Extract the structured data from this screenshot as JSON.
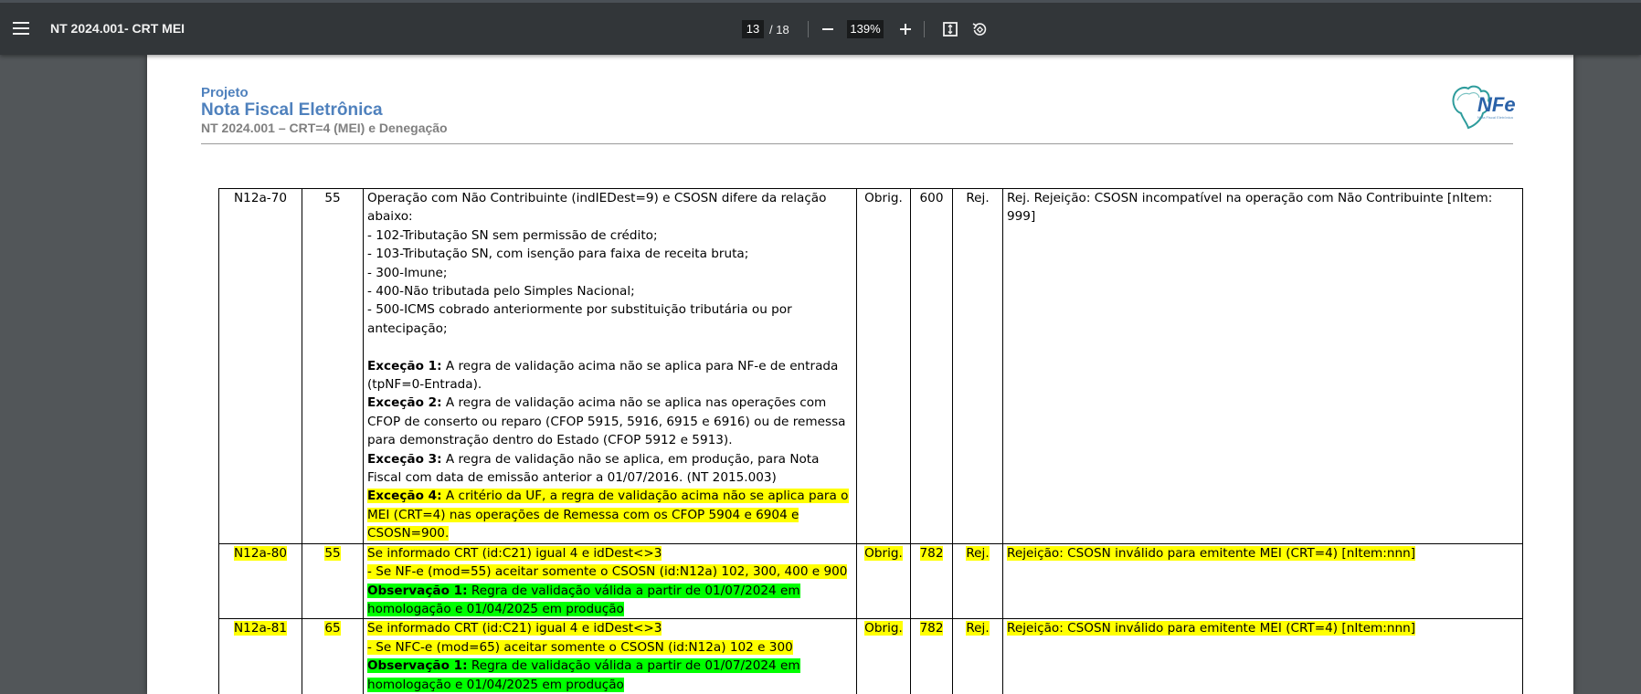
{
  "viewer": {
    "title": "NT 2024.001- CRT MEI",
    "current_page": "13",
    "total_pages": "/ 18",
    "zoom": "139%"
  },
  "doc_header": {
    "line1": "Projeto",
    "line2": "Nota Fiscal Eletrônica",
    "line3": "NT 2024.001 – CRT=4 (MEI) e Denegação",
    "logo_text": "NFe",
    "logo_subtext": "Nota Fiscal Eletrônica"
  },
  "colors": {
    "highlight_yellow": "#ffff00",
    "highlight_green": "#00ff00",
    "header_blue": "#4f81bd",
    "toolbar": "#323639"
  },
  "rows": [
    {
      "id": "N12a-70",
      "mod": "55",
      "desc": {
        "p1": "Operação com Não Contribuinte (indIEDest=9) e CSOSN difere da relação abaixo:",
        "items": [
          "- 102-Tributação SN sem permissão de crédito;",
          "- 103-Tributação SN, com isenção para faixa de receita bruta;",
          "- 300-Imune;",
          "- 400-Não tributada pelo Simples Nacional;",
          "- 500-ICMS cobrado anteriormente por substituição tributária ou por antecipação;"
        ],
        "exc1_label": "Exceção 1:",
        "exc1_text": " A regra de validação acima não se aplica para NF-e de entrada (tpNF=0-Entrada).",
        "exc2_label": "Exceção 2:",
        "exc2_text": " A regra de validação acima não se aplica nas operações com CFOP de conserto ou reparo (CFOP 5915, 5916, 6915 e 6916) ou de remessa para demonstração dentro do Estado (CFOP 5912 e 5913).",
        "exc3_label": "Exceção 3:",
        "exc3_text": " A regra de validação não se aplica, em produção, para Nota Fiscal com data de emissão anterior a 01/07/2016. (NT 2015.003)",
        "exc4_label": "Exceção 4:",
        "exc4_text": " A critério da UF, a regra de validação acima não se aplica para o MEI (CRT=4) nas operações de Remessa com os CFOP 5904 e 6904 e CSOSN=900."
      },
      "obrig": "Obrig.",
      "code": "600",
      "rej": "Rej.",
      "msg": "Rej. Rejeição: CSOSN incompatível na operação com Não Contribuinte [nItem: 999]"
    },
    {
      "id": "N12a-80",
      "mod": "55",
      "desc": {
        "line1": "Se informado CRT (id:C21) igual 4 e idDest<>3",
        "line2": "- Se NF-e (mod=55) aceitar somente o CSOSN (id:N12a) 102, 300, 400 e 900",
        "obs_label": "Observação 1:",
        "obs_text": " Regra de validação válida a partir de 01/07/2024 em homologação e 01/04/2025 em produção"
      },
      "obrig": "Obrig.",
      "code": "782",
      "rej": "Rej.",
      "msg": "Rejeição: CSOSN inválido para emitente MEI (CRT=4) [nItem:nnn]"
    },
    {
      "id": "N12a-81",
      "mod": "65",
      "desc": {
        "line1": "Se informado CRT (id:C21) igual 4 e idDest<>3",
        "line2": "- Se NFC-e (mod=65) aceitar somente o CSOSN (id:N12a) 102 e 300",
        "obs_label": "Observação 1:",
        "obs_text": " Regra de validação válida a partir de 01/07/2024 em homologação e 01/04/2025 em produção"
      },
      "obrig": "Obrig.",
      "code": "782",
      "rej": "Rej.",
      "msg": "Rejeição: CSOSN inválido para emitente MEI (CRT=4) [nItem:nnn]"
    }
  ]
}
